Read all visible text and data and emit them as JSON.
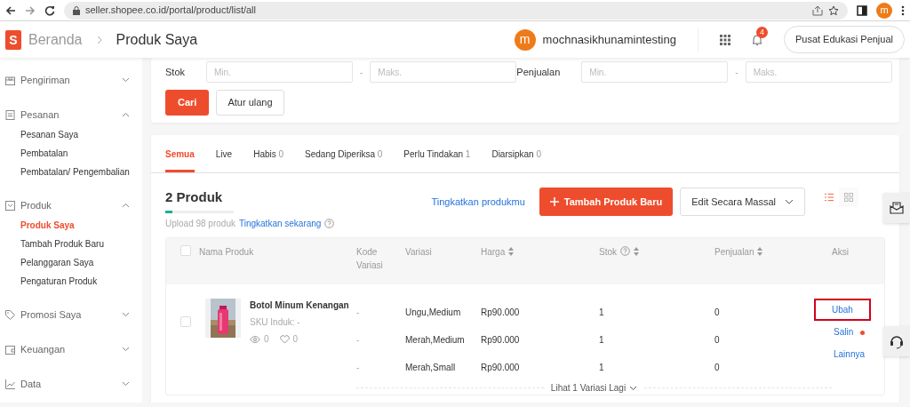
{
  "browser": {
    "url": "seller.shopee.co.id/portal/product/list/all",
    "profile_initial": "m"
  },
  "header": {
    "logo_letter": "S",
    "breadcrumb": [
      "Beranda",
      "Produk Saya"
    ],
    "user": {
      "initial": "m",
      "name": "mochnasikhunamintesting"
    },
    "notification_count": "4",
    "edu_button": "Pusat Edukasi Penjual"
  },
  "sidebar": {
    "sections": [
      {
        "kind": "shipping",
        "label": "Pengiriman",
        "expanded": false
      },
      {
        "kind": "orders",
        "label": "Pesanan",
        "expanded": true,
        "children": [
          {
            "label": "Pesanan Saya",
            "selected": false
          },
          {
            "label": "Pembatalan",
            "selected": false
          },
          {
            "label": "Pembatalan/ Pengembalian",
            "selected": false
          }
        ]
      },
      {
        "kind": "product",
        "label": "Produk",
        "expanded": true,
        "children": [
          {
            "label": "Produk Saya",
            "selected": true
          },
          {
            "label": "Tambah Produk Baru",
            "selected": false
          },
          {
            "label": "Pelanggaran Saya",
            "selected": false
          },
          {
            "label": "Pengaturan Produk",
            "selected": false
          }
        ]
      },
      {
        "kind": "promo",
        "label": "Promosi Saya",
        "expanded": false
      },
      {
        "kind": "finance",
        "label": "Keuangan",
        "expanded": false
      },
      {
        "kind": "data",
        "label": "Data",
        "expanded": false
      }
    ]
  },
  "filter": {
    "ranges": [
      {
        "label": "Stok",
        "min_placeholder": "Min.",
        "separator": "-",
        "max_placeholder": "Maks."
      },
      {
        "label": "Penjualan",
        "min_placeholder": "Min.",
        "separator": "-",
        "max_placeholder": "Maks."
      }
    ],
    "search_button": "Cari",
    "reset_button": "Atur ulang"
  },
  "tabs": [
    {
      "label": "Semua",
      "selected": true
    },
    {
      "label": "Live",
      "selected": false
    },
    {
      "label": "Habis",
      "count": "0",
      "selected": false
    },
    {
      "label": "Sedang Diperiksa",
      "count": "0",
      "selected": false
    },
    {
      "label": "Perlu Tindakan",
      "count": "1",
      "selected": false
    },
    {
      "label": "Diarsipkan",
      "count": "0",
      "selected": false
    }
  ],
  "summary": {
    "title": "2 Produk",
    "level": 0.1,
    "upload_text": "Upload 98 produk",
    "upgrade_link": "Tingkatkan sekarang"
  },
  "actions": {
    "upgrade_link": "Tingkatkan produkmu",
    "add_button": "Tambah Produk Baru",
    "bulk_edit": "Edit Secara Massal",
    "view_modes": [
      {
        "kind": "list",
        "selected": true
      },
      {
        "kind": "grid",
        "selected": false
      }
    ]
  },
  "table": {
    "select_all_checked": false,
    "columns": [
      {
        "label": "Nama Produk",
        "sortable": false,
        "help": false
      },
      {
        "label": "Kode Variasi",
        "sortable": false,
        "help": false
      },
      {
        "label": "Variasi",
        "sortable": false,
        "help": false
      },
      {
        "label": "Harga",
        "sortable": true,
        "help": false
      },
      {
        "label": "Stok",
        "sortable": true,
        "help": true
      },
      {
        "label": "Penjualan",
        "sortable": true,
        "help": false
      },
      {
        "label": "Aksi",
        "sortable": false,
        "help": false
      }
    ],
    "rows": [
      {
        "checked": false,
        "name": "Botol Minum Kenangan",
        "sku": "SKU Induk: -",
        "views": "0",
        "likes": "0",
        "variations": [
          {
            "code": "-",
            "name": "Ungu,Medium",
            "price": "Rp90.000",
            "stock": "1",
            "sales": "0"
          },
          {
            "code": "-",
            "name": "Merah,Medium",
            "price": "Rp90.000",
            "stock": "1",
            "sales": "0"
          },
          {
            "code": "-",
            "name": "Merah,Small",
            "price": "Rp90.000",
            "stock": "1",
            "sales": "0"
          }
        ],
        "actions": [
          {
            "label": "Ubah",
            "highlighted": true,
            "dot": false
          },
          {
            "label": "Salin",
            "highlighted": false,
            "dot": true
          },
          {
            "label": "Lainnya",
            "highlighted": false,
            "dot": false
          }
        ],
        "more": "Lihat 1 Variasi Lagi"
      }
    ]
  }
}
